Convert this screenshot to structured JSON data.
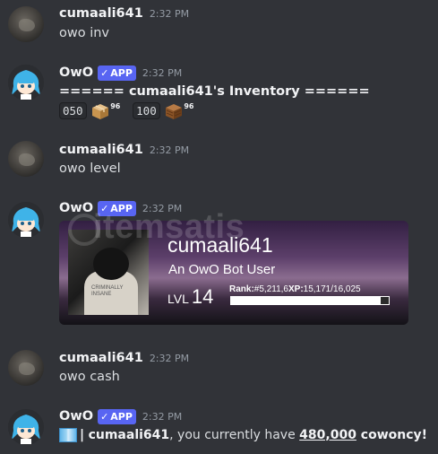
{
  "user": {
    "name": "cumaali641",
    "time": "2:32 PM"
  },
  "bot": {
    "name": "OwO",
    "badge": "APP",
    "time": "2:32 PM"
  },
  "messages": {
    "m1": {
      "text": "owo inv"
    },
    "m2": {
      "title": "====== cumaali641's Inventory ======",
      "items": [
        {
          "code": "050",
          "count": "96",
          "icon": "package-box-icon"
        },
        {
          "code": "100",
          "count": "96",
          "icon": "wooden-crate-icon"
        }
      ]
    },
    "m3": {
      "text": "owo level"
    },
    "m4": {
      "card": {
        "username": "cumaali641",
        "subtitle": "An OwO Bot User",
        "lvl_label": "LVL",
        "lvl_value": "14",
        "rank_label": "Rank:",
        "rank_value": "#5,211,6",
        "xp_label": "XP:",
        "xp_value": "15,171/16,025",
        "xp_progress": 0.947
      },
      "watermark": "itemsatis"
    },
    "m5": {
      "text": "owo cash"
    },
    "m6": {
      "sep": "|",
      "name": "cumaali641",
      "mid": ", you currently have ",
      "amount": "480,000",
      "end": " cowoncy!"
    }
  },
  "colors": {
    "background": "#313338",
    "badge": "#5865f2",
    "text": "#dbdee1"
  }
}
